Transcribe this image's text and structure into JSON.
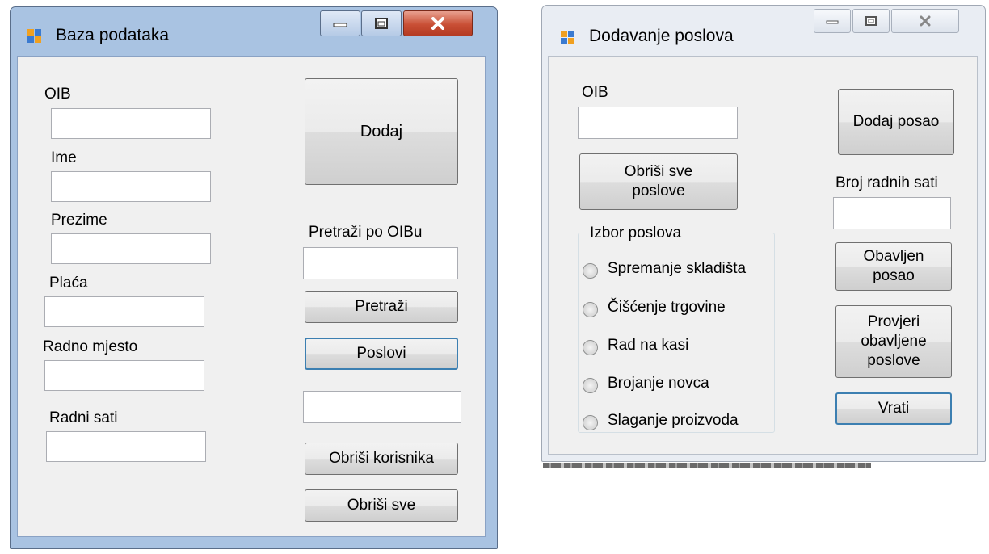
{
  "window1": {
    "title": "Baza podataka",
    "fields": [
      {
        "label": "OIB",
        "value": ""
      },
      {
        "label": "Ime",
        "value": ""
      },
      {
        "label": "Prezime",
        "value": ""
      },
      {
        "label": "Plaća",
        "value": ""
      },
      {
        "label": "Radno mjesto",
        "value": ""
      },
      {
        "label": "Radni sati",
        "value": ""
      }
    ],
    "add_button": "Dodaj",
    "search_label": "Pretraži po OIBu",
    "search_value": "",
    "search_button": "Pretraži",
    "jobs_button": "Poslovi",
    "result_value": "",
    "delete_user_button": "Obriši korisnika",
    "delete_all_button": "Obriši sve"
  },
  "window2": {
    "title": "Dodavanje poslova",
    "oib_label": "OIB",
    "oib_value": "",
    "add_job_button": "Dodaj posao",
    "delete_all_jobs_button": "Obriši sve\nposlove",
    "hours_label": "Broj radnih sati",
    "hours_value": "",
    "group_title": "Izbor poslova",
    "job_options": [
      "Spremanje skladišta",
      "Čišćenje trgovine",
      "Rad na kasi",
      "Brojanje novca",
      "Slaganje proizvoda"
    ],
    "done_button": "Obavljen\nposao",
    "check_button": "Provjeri\nobavljene\nposlove",
    "back_button": "Vrati"
  },
  "icons": {
    "app_icon": "windows-form-icon",
    "minimize": "minimize-icon",
    "maximize": "maximize-icon",
    "close": "close-icon"
  }
}
